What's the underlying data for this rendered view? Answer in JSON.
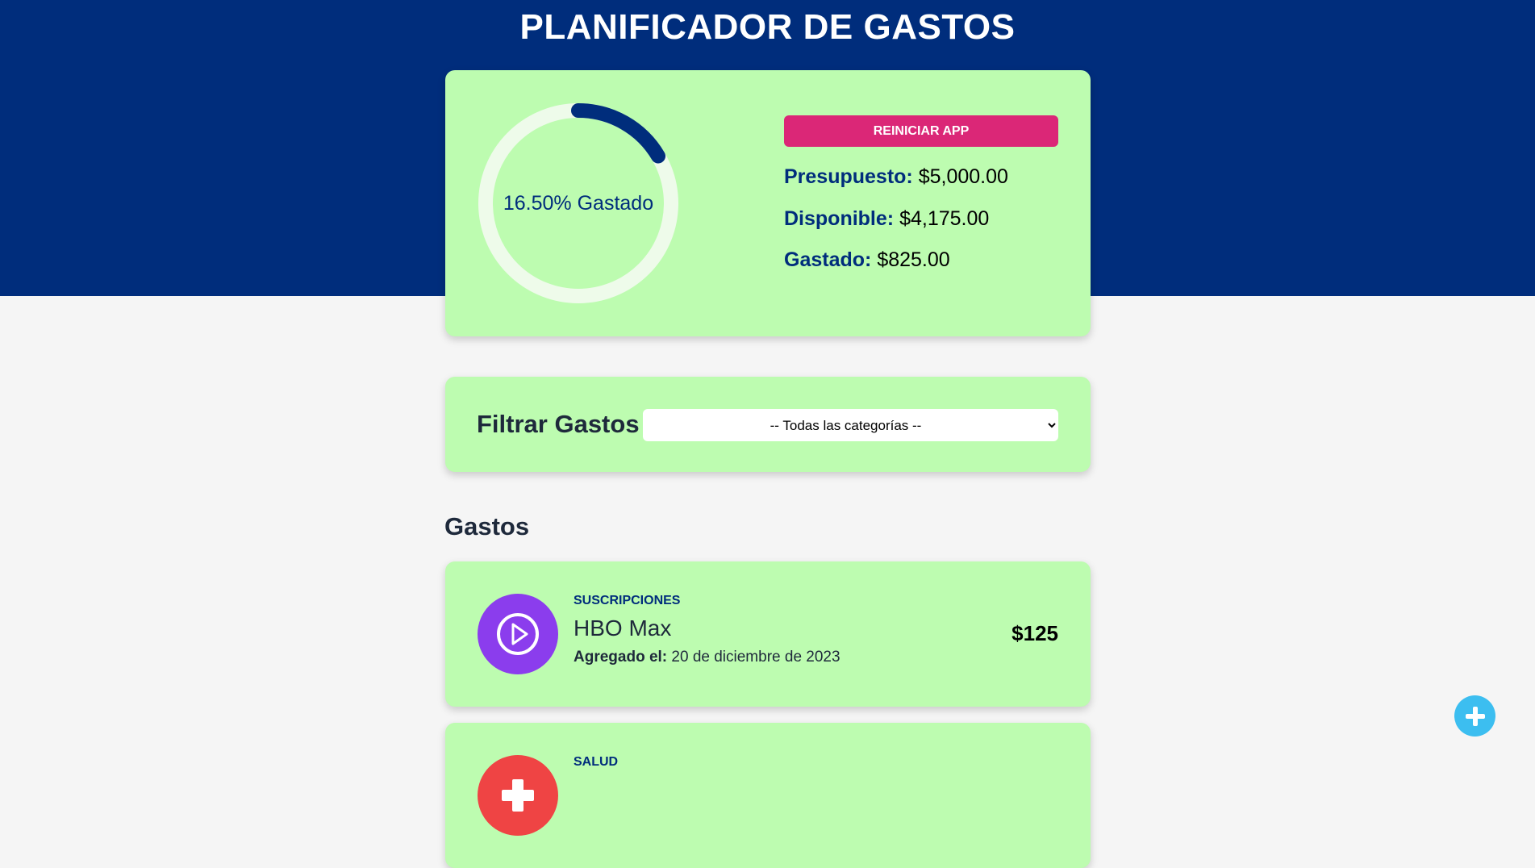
{
  "app": {
    "title": "PLANIFICADOR DE GASTOS"
  },
  "budget": {
    "progress_label": "16.50% Gastado",
    "progress_fraction": 0.165,
    "reset_label": "REINICIAR APP",
    "budget_key": "Presupuesto:",
    "budget_value": "$5,000.00",
    "available_key": "Disponible:",
    "available_value": "$4,175.00",
    "spent_key": "Gastado:",
    "spent_value": "$825.00"
  },
  "filter": {
    "title": "Filtrar Gastos",
    "selected_option": "-- Todas las categorías --"
  },
  "expenses": {
    "section_title": "Gastos",
    "date_key": "Agregado el:",
    "items": [
      {
        "category": "SUSCRIPCIONES",
        "name": "HBO Max",
        "date": "20 de diciembre de 2023",
        "amount": "$125",
        "icon": "play-icon",
        "color": "#8b3ded"
      },
      {
        "category": "SALUD",
        "name": "",
        "date": "",
        "amount": "",
        "icon": "health-icon",
        "color": "#ef4444"
      }
    ]
  },
  "colors": {
    "header": "#002d7c",
    "card": "#bdfcb0",
    "accent_pink": "#db2777",
    "progress": "#002d7c",
    "progress_track": "#eefbea",
    "add_button": "#3cbef0"
  }
}
